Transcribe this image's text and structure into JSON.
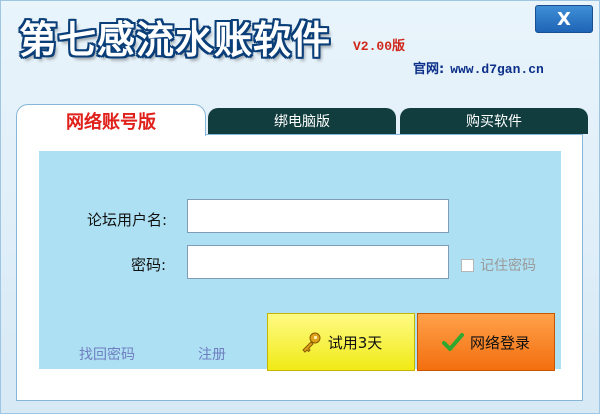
{
  "window": {
    "title": "第七感流水账软件",
    "version": "V2.00版",
    "close_label": "X",
    "website_label": "官网:",
    "website_url": "www.d7gan.cn"
  },
  "tabs": [
    {
      "label": "网络账号版",
      "active": true
    },
    {
      "label": "绑电脑版",
      "active": false
    },
    {
      "label": "购买软件",
      "active": false
    }
  ],
  "form": {
    "username_label": "论坛用户名:",
    "username_value": "",
    "password_label": "密码:",
    "password_value": "",
    "remember_label": "记住密码",
    "remember_checked": false
  },
  "links": {
    "forgot_password": "找回密码",
    "register": "注册"
  },
  "buttons": {
    "trial_label": "试用3天",
    "login_label": "网络登录"
  },
  "colors": {
    "title_outline": "#0a3e79",
    "version": "#d0281c",
    "active_tab_text": "#e0201a",
    "inactive_tab_bg": "#123d3f",
    "form_bg": "#aee0f3",
    "trial_button": "#f0ea16",
    "login_button": "#f36f0f"
  },
  "icons": {
    "trial": "key-icon",
    "login": "checkmark-icon"
  }
}
